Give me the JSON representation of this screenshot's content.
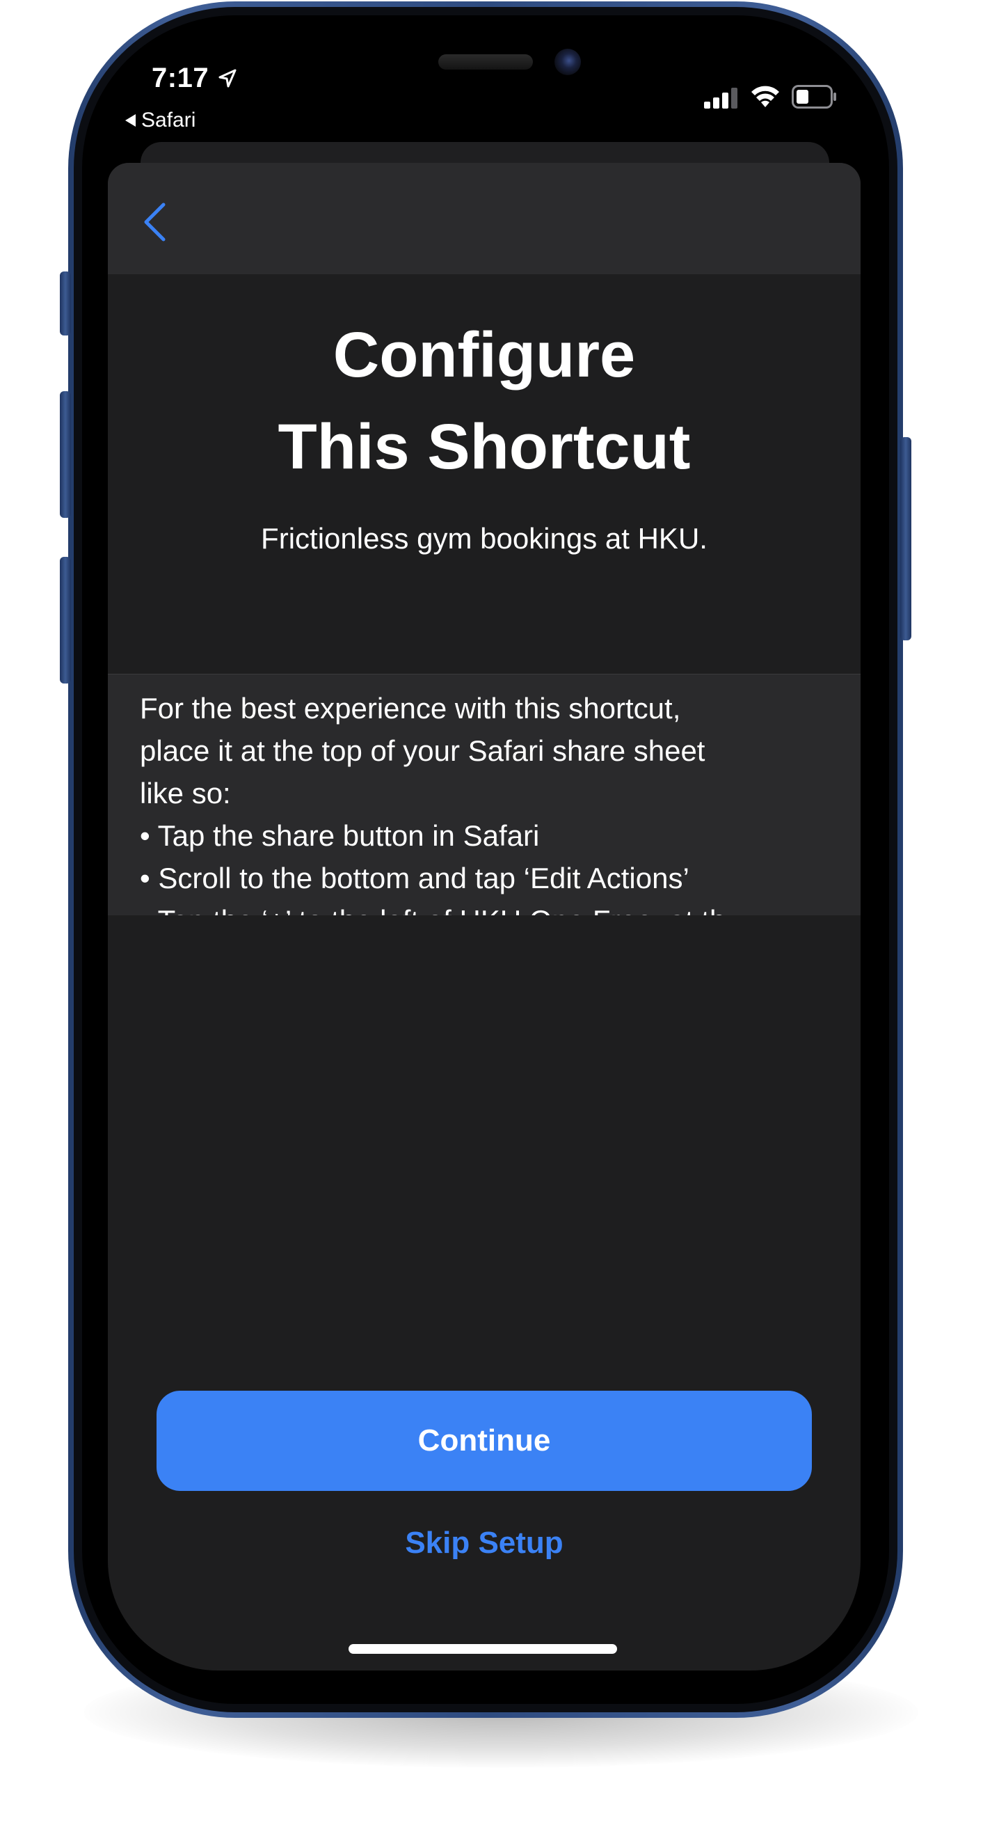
{
  "status_bar": {
    "time": "7:17",
    "back_app_label": "Safari",
    "icons": [
      "location-arrow-icon",
      "cellular-signal-icon",
      "wifi-icon",
      "battery-icon"
    ]
  },
  "nav": {
    "back_icon": "chevron-left-icon"
  },
  "sheet": {
    "title_line1": "Configure",
    "title_line2": "This Shortcut",
    "subtitle": "Frictionless gym bookings at HKU.",
    "description_lines": [
      "For the best experience with this shortcut,",
      "place it at the top of your Safari share sheet",
      "like so:",
      "• Tap the share button in Safari",
      "• Scroll to the bottom and tap ‘Edit Actions’",
      "• Tap the ‘+’ to the left of HKU One Free, at th"
    ]
  },
  "actions": {
    "continue_label": "Continue",
    "skip_label": "Skip Setup"
  },
  "colors": {
    "accent": "#3b82f5",
    "sheet_background": "#1e1e1f",
    "nav_background": "#2b2b2d",
    "description_background": "#2a2a2c",
    "phone_frame": "#2e4b80"
  }
}
